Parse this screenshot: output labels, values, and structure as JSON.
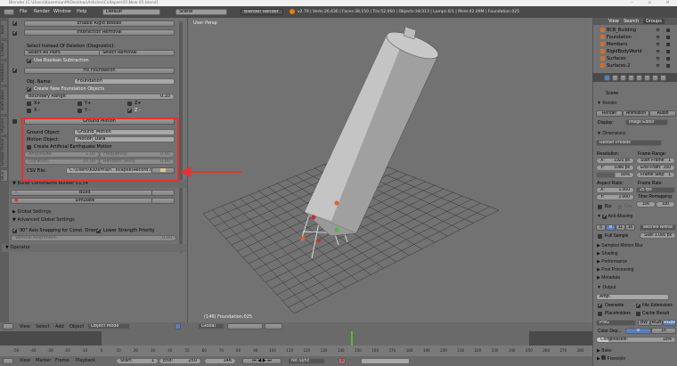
{
  "title": "Blender [C:\\Users\\KazemianM\\Desktop\\Articles\\Collapse\\01\\New 05.blend]",
  "window_controls": {
    "minimize": "–",
    "maximize": "▫",
    "close": "✕"
  },
  "top_header": {
    "menus": [
      "File",
      "Render",
      "Window",
      "Help"
    ],
    "layout": "Default",
    "scene": "Scene",
    "engine": "Blender Render",
    "stats": "v2.79 | Verts:26,636 | Faces:38,150 | Tris:52,060 | Objects:34/313 | Lamps:0/1 | Mem:42.09M | Foundation.025"
  },
  "tool_tabs": [
    "Tools",
    "Create",
    "Relations",
    "Animation",
    "Physics",
    "Grease Pencil",
    "BCB"
  ],
  "left_panel": {
    "enable_rigid_bodies": "Enable Rigid Bodies",
    "interaction_removal": "Interaction Removal",
    "select_instead": "Select Instead Of Deletion (Diagnostic):",
    "select_all_pairs": "Select All Pairs",
    "select_removal": "Select Removal",
    "use_boolean": "Use Boolean Subtraction",
    "fix_foundation": "Fix Foundation",
    "obj_name_label": "Obj. Name:",
    "obj_name_value": "Foundation",
    "create_new_foundation": "Create New Foundation Objects",
    "boundary_range_label": "Boundary Range:",
    "boundary_range_value": "0.10",
    "axes": [
      "X+",
      "Y+",
      "Z+",
      "X -",
      "Y -",
      "Z -"
    ],
    "ground_motion": "Ground Motion",
    "ground_object_label": "Ground Object:",
    "ground_object_value": "Ground_Motion",
    "motion_object_label": "Motion Object:",
    "motion_object_value": "Motion_Data",
    "artificial_eq": "Create Artificial Earthquake Motion",
    "amplitude_label": "Amplitude:",
    "amplitude_value": "1.00",
    "frequency_label": "Frequency:",
    "frequency_value": "0.50",
    "duration_label": "Duration:",
    "duration_value": "10.00",
    "seed_label": "Random Seed:",
    "seed_value": "0.00",
    "csv_label": "CSV File:",
    "csv_value": "C:\\Users\\Kazemian...ollapse\\Record.csv",
    "bcb_title": "Bullet Constraints Builder v3.54",
    "build": "Build",
    "simulate": "Simulate",
    "global_settings": "Global Settings",
    "advanced_global": "Advanced Global Settings",
    "axis_snapping": "90° Axis Snapping for Const. Orient.",
    "lower_strength": "Lower Strength Priority",
    "vertical_alignment_label": "Vertical Alignment:",
    "vertical_alignment_value": "0.00",
    "operator": "Operator"
  },
  "viewport": {
    "view_name": "User Persp",
    "object_info": "(146) Foundation.025"
  },
  "viewport_header": {
    "menus": [
      "View",
      "Select",
      "Add",
      "Object"
    ],
    "mode": "Object Mode",
    "orientation": "Global"
  },
  "outliner": {
    "tabs": [
      "View",
      "Search",
      "Groups"
    ],
    "items": [
      "BCB_Building",
      "Foundation",
      "Members",
      "RigidBodyWorld",
      "Surfaces",
      "Surfaces.2"
    ]
  },
  "properties": {
    "breadcrumb": "Scene",
    "render": "Render",
    "render_btn": "Render",
    "animation_btn": "Animation",
    "audio_btn": "Audio",
    "display_label": "Display:",
    "display_value": "Image Editor",
    "dimensions": "Dimensions",
    "presets": "Render Presets",
    "resolution": "Resolution:",
    "res_x": "X:",
    "res_x_val": "1920 px",
    "res_y": "Y:",
    "res_y_val": "1080 px",
    "res_pct": "50%",
    "frame_range": "Frame Range:",
    "start_frame": "Start Frame:",
    "start_val": "1",
    "end_frame": "End Fram:",
    "end_val": "250",
    "frame_step": "Frame Step:",
    "step_val": "1",
    "aspect": "Aspect Ratio:",
    "asp_x": "X:",
    "asp_x_val": "1.000",
    "asp_y": "Y:",
    "asp_y_val": "1.000",
    "frame_rate": "Frame Rate:",
    "fps": "25 fps",
    "time_remap": "Time Remapping:",
    "remap_old": "100",
    "remap_new": "100",
    "border": "Bor",
    "crop": "Cro",
    "anti_aliasing": "Anti-Aliasing",
    "aa_samples": [
      "5",
      "8",
      "11",
      "16"
    ],
    "filter": "Mitchell-Netrav",
    "full_sample": "Full Sample",
    "size_label": "Size:",
    "size_val": "1.000 px",
    "collapsed": [
      "Sampled Motion Blur",
      "Shading",
      "Performance",
      "Post Processing",
      "Metadata"
    ],
    "output": "Output",
    "output_path": "Amp\\",
    "overwrite": "Overwrite",
    "file_ext": "File Extensions",
    "placeholders": "Placeholders",
    "cache_result": "Cache Result",
    "format": "PNG",
    "bw": "BW",
    "rgb": "RGB",
    "rgba": "RGBA",
    "color_depth": "Color Dep...",
    "depth_8": "8",
    "depth_16": "16",
    "compression_label": "Compression:",
    "compression_val": "15%",
    "bake": "Bake",
    "freestyle": "Freestyle"
  },
  "timeline": {
    "menus": [
      "View",
      "Marker",
      "Frame",
      "Playback"
    ],
    "start_label": "Start:",
    "start": "1",
    "end_label": "End:",
    "end": "250",
    "current": "146",
    "sync": "No Sync",
    "ticks": [
      "-50",
      "-40",
      "-30",
      "-20",
      "-10",
      "0",
      "10",
      "20",
      "30",
      "40",
      "50",
      "60",
      "70",
      "80",
      "90",
      "100",
      "110",
      "120",
      "130",
      "140",
      "150",
      "160",
      "170",
      "180",
      "190",
      "200",
      "210",
      "220",
      "230",
      "240",
      "250",
      "260",
      "270",
      "280"
    ],
    "current_frame": 146,
    "range_start": 0,
    "range_end": 250
  },
  "colors": {
    "highlight": "#e83030",
    "playhead": "#50c030",
    "accent": "#5680c2"
  }
}
